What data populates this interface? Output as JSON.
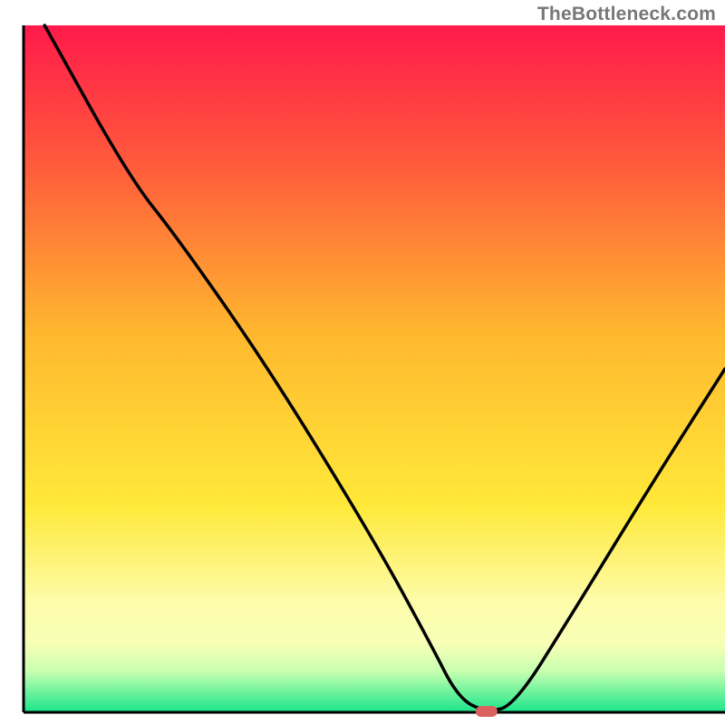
{
  "watermark": "TheBottleneck.com",
  "chart_data": {
    "type": "line",
    "title": "",
    "xlabel": "",
    "ylabel": "",
    "xlim": [
      0,
      100
    ],
    "ylim": [
      0,
      100
    ],
    "axes_drawn": [
      "left",
      "bottom"
    ],
    "background_gradient": {
      "stops": [
        {
          "pos": 0.0,
          "color": "#ff1a4a"
        },
        {
          "pos": 0.2,
          "color": "#ff5a3c"
        },
        {
          "pos": 0.45,
          "color": "#ffb82e"
        },
        {
          "pos": 0.7,
          "color": "#ffe93a"
        },
        {
          "pos": 0.84,
          "color": "#fdfcaa"
        },
        {
          "pos": 0.9,
          "color": "#f8ffb6"
        },
        {
          "pos": 0.94,
          "color": "#c8ffb0"
        },
        {
          "pos": 0.965,
          "color": "#7ef5a0"
        },
        {
          "pos": 1.0,
          "color": "#19e58a"
        }
      ]
    },
    "curve": {
      "description": "V-shaped bottleneck curve with minimum around x≈66",
      "points": [
        {
          "x": 3,
          "y": 100
        },
        {
          "x": 15,
          "y": 78
        },
        {
          "x": 22,
          "y": 69
        },
        {
          "x": 35,
          "y": 50
        },
        {
          "x": 50,
          "y": 25
        },
        {
          "x": 58,
          "y": 10
        },
        {
          "x": 62,
          "y": 2
        },
        {
          "x": 66,
          "y": 0
        },
        {
          "x": 70,
          "y": 1
        },
        {
          "x": 78,
          "y": 14
        },
        {
          "x": 90,
          "y": 34
        },
        {
          "x": 100,
          "y": 50
        }
      ]
    },
    "marker": {
      "x": 66,
      "y": 0,
      "color": "#d9625f",
      "shape": "rounded-pill"
    }
  }
}
